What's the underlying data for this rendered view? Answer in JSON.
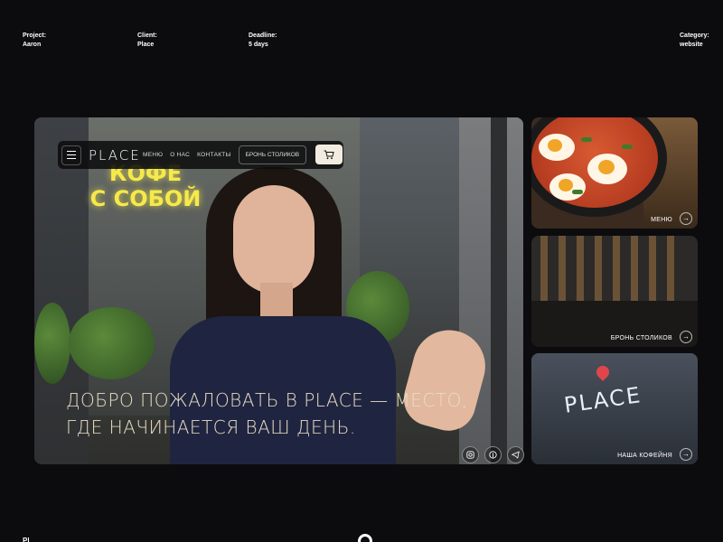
{
  "meta": {
    "project_label": "Project:",
    "project_value": "Aaron",
    "client_label": "Client:",
    "client_value": "Place",
    "deadline_label": "Deadline:",
    "deadline_value": "5 days",
    "category_label": "Category:",
    "category_value": "website"
  },
  "nav": {
    "logo": "PLACE",
    "links": [
      "МЕНЮ",
      "О НАС",
      "КОНТАКТЫ"
    ],
    "book_button": "БРОНЬ СТОЛИКОВ"
  },
  "hero": {
    "neon_line1": "КОФЕ",
    "neon_line2": "С СОБОЙ",
    "headline_line1": "ДОБРО ПОЖАЛОВАТЬ В PLACE — МЕСТО,",
    "headline_line2": "ГДЕ НАЧИНАЕТСЯ ВАШ ДЕНЬ."
  },
  "socials": [
    "instagram-icon",
    "pinterest-icon",
    "telegram-icon"
  ],
  "cards": [
    {
      "label": "МЕНЮ"
    },
    {
      "label": "БРОНЬ СТОЛИКОВ"
    },
    {
      "label": "НАША КОФЕЙНЯ",
      "sign": "PLACE"
    }
  ],
  "footer": {
    "left": "Pl"
  },
  "colors": {
    "background": "#0c0c0f",
    "headline": "#e9dcc4",
    "neon": "#f6e94a",
    "cart": "#f2ece0"
  }
}
